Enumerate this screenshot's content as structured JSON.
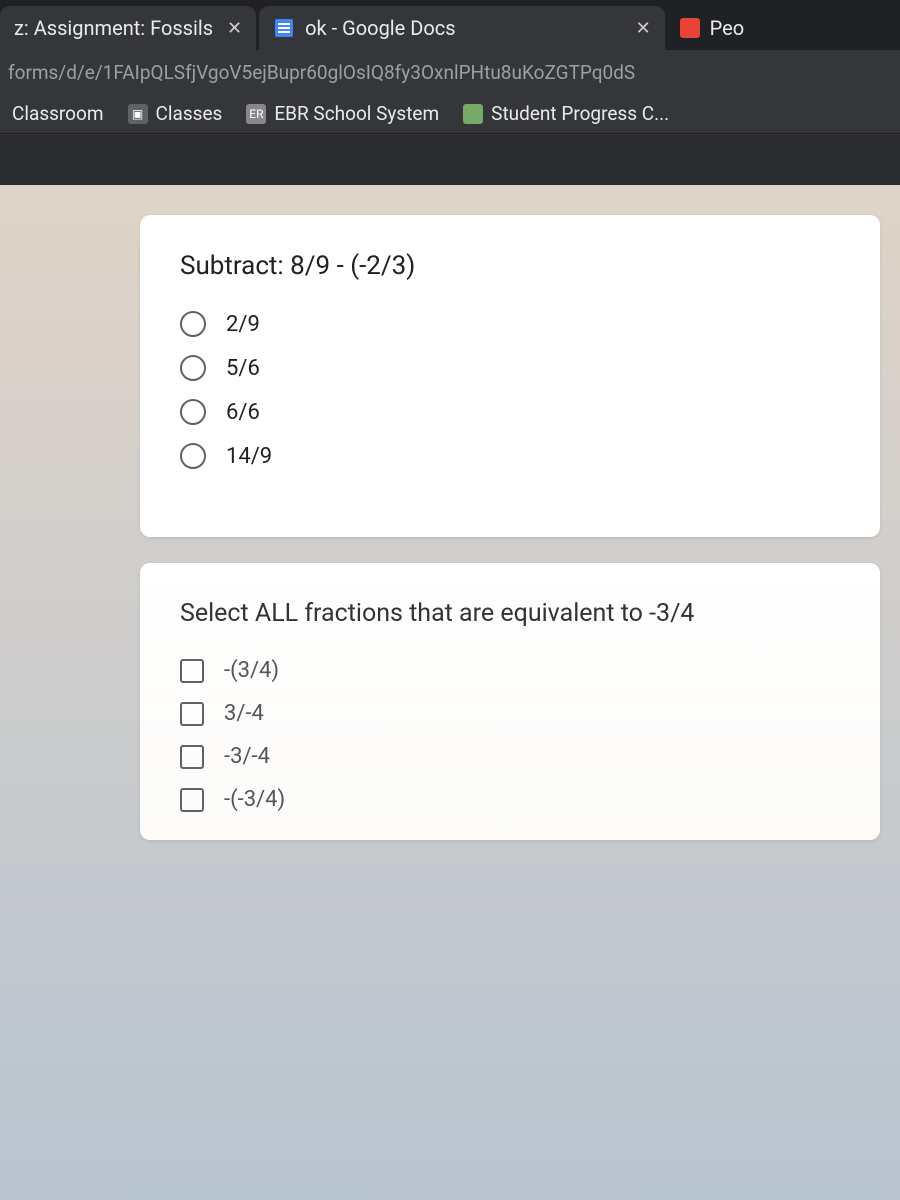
{
  "tabs": [
    {
      "title": "z: Assignment: Fossils"
    },
    {
      "title": "ok - Google Docs"
    },
    {
      "title": "Peo"
    }
  ],
  "url": "forms/d/e/1FAIpQLSfjVgoV5ejBupr60glOsIQ8fy3OxnlPHtu8uKoZGTPq0dS",
  "bookmarks": [
    {
      "label": "Classroom"
    },
    {
      "label": "Classes"
    },
    {
      "label": "EBR School System"
    },
    {
      "label": "Student Progress C..."
    }
  ],
  "q1": {
    "title": "Subtract: 8/9 - (-2/3)",
    "options": [
      "2/9",
      "5/6",
      "6/6",
      "14/9"
    ]
  },
  "q2": {
    "title": "Select ALL fractions that are equivalent to -3/4",
    "options": [
      "-(3/4)",
      "3/-4",
      "-3/-4",
      "-(-3/4)"
    ]
  }
}
